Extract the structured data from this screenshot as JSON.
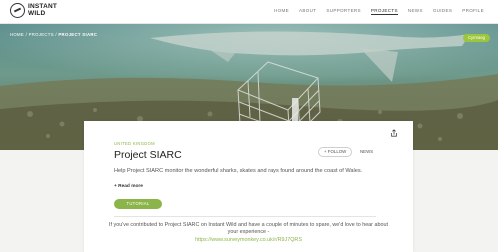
{
  "logo": {
    "line1": "INSTANT",
    "line2": "WILD"
  },
  "nav": {
    "items": [
      "HOME",
      "ABOUT",
      "SUPPORTERS",
      "PROJECTS",
      "NEWS",
      "GUIDES",
      "PROFILE"
    ],
    "active": "PROJECTS"
  },
  "breadcrumb": {
    "home": "HOME",
    "projects": "PROJECTS",
    "current": "PROJECT SIARC",
    "sep": " / "
  },
  "hero": {
    "badge": "Cymraeg"
  },
  "project": {
    "country": "UNITED KINGDOM",
    "title": "Project SIARC",
    "follow": "+ FOLLOW",
    "news": "NEWS",
    "description": "Help Project SIARC monitor the wonderful sharks, skates and rays found around the coast of Wales.",
    "read_more": "+ Read more",
    "tutorial": "TUTORIAL",
    "survey_text": "If you've contributed to Project SIARC on Instant Wild and have a couple of minutes to spare, we'd love to hear about your experience -",
    "survey_link": "https://www.surveymonkey.co.uk/r/R9J7QRS"
  },
  "colors": {
    "accent": "#8bb54a",
    "badge": "#9cc63b"
  },
  "icons": {
    "share": "share-icon",
    "logo": "logo-icon"
  }
}
